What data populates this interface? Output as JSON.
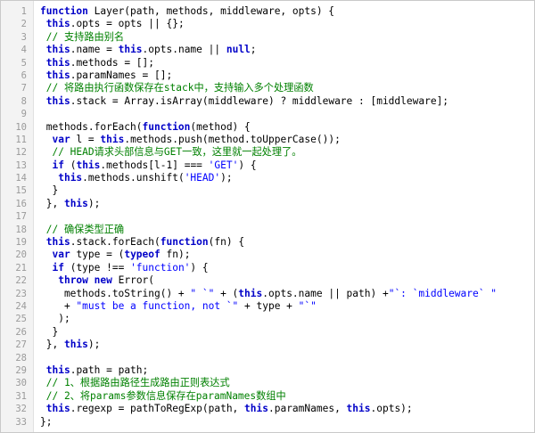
{
  "colors": {
    "keyword": "#0000c8",
    "comment": "#008000",
    "string": "#0000ff",
    "line_number": "#9a9a9a",
    "gutter_background": "#f3f3f3"
  },
  "code_lines": [
    {
      "number": "1",
      "tokens": [
        [
          "kw",
          "function"
        ],
        [
          "plain",
          " Layer(path, methods, middleware, opts) {"
        ]
      ]
    },
    {
      "number": "2",
      "tokens": [
        [
          "plain",
          " "
        ],
        [
          "kw",
          "this"
        ],
        [
          "plain",
          ".opts = opts || {};"
        ]
      ]
    },
    {
      "number": "3",
      "tokens": [
        [
          "cm",
          " // 支持路由别名"
        ]
      ]
    },
    {
      "number": "4",
      "tokens": [
        [
          "plain",
          " "
        ],
        [
          "kw",
          "this"
        ],
        [
          "plain",
          ".name = "
        ],
        [
          "kw",
          "this"
        ],
        [
          "plain",
          ".opts.name || "
        ],
        [
          "kw",
          "null"
        ],
        [
          "plain",
          ";"
        ]
      ]
    },
    {
      "number": "5",
      "tokens": [
        [
          "plain",
          " "
        ],
        [
          "kw",
          "this"
        ],
        [
          "plain",
          ".methods = [];"
        ]
      ]
    },
    {
      "number": "6",
      "tokens": [
        [
          "plain",
          " "
        ],
        [
          "kw",
          "this"
        ],
        [
          "plain",
          ".paramNames = [];"
        ]
      ]
    },
    {
      "number": "7",
      "tokens": [
        [
          "cm",
          " // 将路由执行函数保存在stack中，支持输入多个处理函数"
        ]
      ]
    },
    {
      "number": "8",
      "tokens": [
        [
          "plain",
          " "
        ],
        [
          "kw",
          "this"
        ],
        [
          "plain",
          ".stack = Array.isArray(middleware) ? middleware : [middleware];"
        ]
      ]
    },
    {
      "number": "9",
      "tokens": []
    },
    {
      "number": "10",
      "tokens": [
        [
          "plain",
          " methods.forEach("
        ],
        [
          "kw",
          "function"
        ],
        [
          "plain",
          "(method) {"
        ]
      ]
    },
    {
      "number": "11",
      "tokens": [
        [
          "plain",
          "  "
        ],
        [
          "kw",
          "var"
        ],
        [
          "plain",
          " l = "
        ],
        [
          "kw",
          "this"
        ],
        [
          "plain",
          ".methods.push(method.toUpperCase());"
        ]
      ]
    },
    {
      "number": "12",
      "tokens": [
        [
          "cm",
          "  // HEAD请求头部信息与GET一致，这里就一起处理了。"
        ]
      ]
    },
    {
      "number": "13",
      "tokens": [
        [
          "plain",
          "  "
        ],
        [
          "kw",
          "if"
        ],
        [
          "plain",
          " ("
        ],
        [
          "kw",
          "this"
        ],
        [
          "plain",
          ".methods[l-1] === "
        ],
        [
          "str",
          "'GET'"
        ],
        [
          "plain",
          ") {"
        ]
      ]
    },
    {
      "number": "14",
      "tokens": [
        [
          "plain",
          "   "
        ],
        [
          "kw",
          "this"
        ],
        [
          "plain",
          ".methods.unshift("
        ],
        [
          "str",
          "'HEAD'"
        ],
        [
          "plain",
          ");"
        ]
      ]
    },
    {
      "number": "15",
      "tokens": [
        [
          "plain",
          "  }"
        ]
      ]
    },
    {
      "number": "16",
      "tokens": [
        [
          "plain",
          " }, "
        ],
        [
          "kw",
          "this"
        ],
        [
          "plain",
          ");"
        ]
      ]
    },
    {
      "number": "17",
      "tokens": []
    },
    {
      "number": "18",
      "tokens": [
        [
          "cm",
          " // 确保类型正确"
        ]
      ]
    },
    {
      "number": "19",
      "tokens": [
        [
          "plain",
          " "
        ],
        [
          "kw",
          "this"
        ],
        [
          "plain",
          ".stack.forEach("
        ],
        [
          "kw",
          "function"
        ],
        [
          "plain",
          "(fn) {"
        ]
      ]
    },
    {
      "number": "20",
      "tokens": [
        [
          "plain",
          "  "
        ],
        [
          "kw",
          "var"
        ],
        [
          "plain",
          " type = ("
        ],
        [
          "kw",
          "typeof"
        ],
        [
          "plain",
          " fn);"
        ]
      ]
    },
    {
      "number": "21",
      "tokens": [
        [
          "plain",
          "  "
        ],
        [
          "kw",
          "if"
        ],
        [
          "plain",
          " (type !== "
        ],
        [
          "str",
          "'function'"
        ],
        [
          "plain",
          ") {"
        ]
      ]
    },
    {
      "number": "22",
      "tokens": [
        [
          "plain",
          "   "
        ],
        [
          "kw",
          "throw"
        ],
        [
          "plain",
          " "
        ],
        [
          "kw",
          "new"
        ],
        [
          "plain",
          " Error("
        ]
      ]
    },
    {
      "number": "23",
      "tokens": [
        [
          "plain",
          "    methods.toString() + "
        ],
        [
          "str",
          "\" `\""
        ],
        [
          "plain",
          " + ("
        ],
        [
          "kw",
          "this"
        ],
        [
          "plain",
          ".opts.name || path) +"
        ],
        [
          "str",
          "\"`: `middleware` \""
        ]
      ]
    },
    {
      "number": "24",
      "tokens": [
        [
          "plain",
          "    + "
        ],
        [
          "str",
          "\"must be a function, not `\""
        ],
        [
          "plain",
          " + type + "
        ],
        [
          "str",
          "\"`\""
        ]
      ]
    },
    {
      "number": "25",
      "tokens": [
        [
          "plain",
          "   );"
        ]
      ]
    },
    {
      "number": "26",
      "tokens": [
        [
          "plain",
          "  }"
        ]
      ]
    },
    {
      "number": "27",
      "tokens": [
        [
          "plain",
          " }, "
        ],
        [
          "kw",
          "this"
        ],
        [
          "plain",
          ");"
        ]
      ]
    },
    {
      "number": "28",
      "tokens": []
    },
    {
      "number": "29",
      "tokens": [
        [
          "plain",
          " "
        ],
        [
          "kw",
          "this"
        ],
        [
          "plain",
          ".path = path;"
        ]
      ]
    },
    {
      "number": "30",
      "tokens": [
        [
          "cm",
          " // 1、根据路由路径生成路由正则表达式"
        ]
      ]
    },
    {
      "number": "31",
      "tokens": [
        [
          "cm",
          " // 2、将params参数信息保存在paramNames数组中"
        ]
      ]
    },
    {
      "number": "32",
      "tokens": [
        [
          "plain",
          " "
        ],
        [
          "kw",
          "this"
        ],
        [
          "plain",
          ".regexp = pathToRegExp(path, "
        ],
        [
          "kw",
          "this"
        ],
        [
          "plain",
          ".paramNames, "
        ],
        [
          "kw",
          "this"
        ],
        [
          "plain",
          ".opts);"
        ]
      ]
    },
    {
      "number": "33",
      "tokens": [
        [
          "plain",
          "};"
        ]
      ]
    }
  ]
}
